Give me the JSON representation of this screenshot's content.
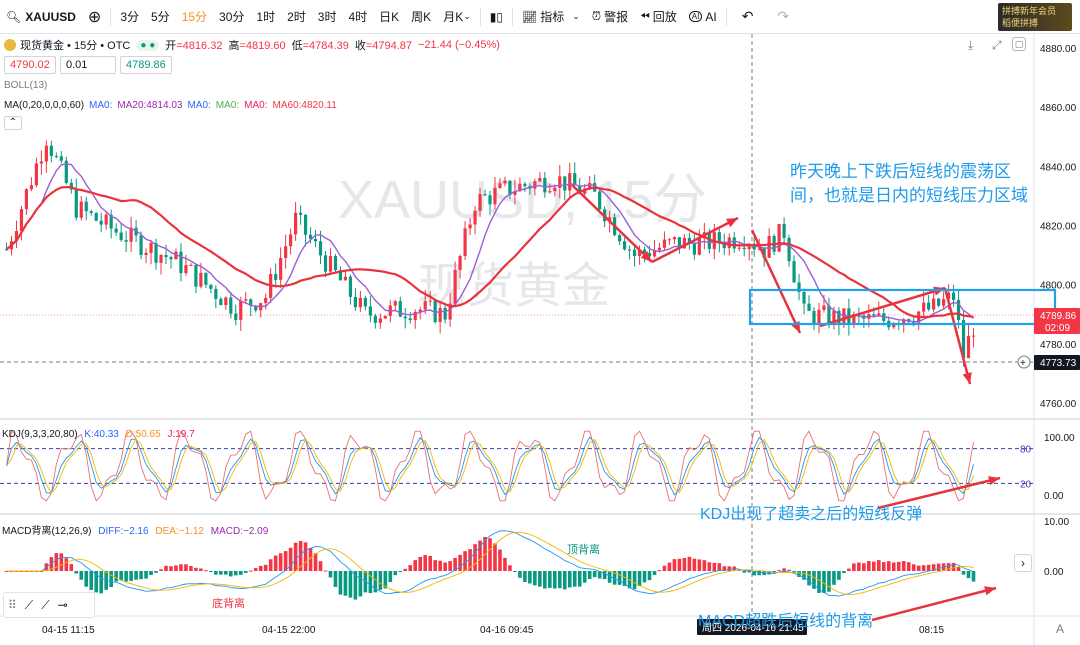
{
  "toolbar": {
    "symbol": "XAUUSD",
    "add_icon": "⊕",
    "intervals": [
      "3分",
      "5分",
      "15分",
      "30分",
      "1时",
      "2时",
      "3时",
      "4时",
      "日K",
      "周K",
      "月K"
    ],
    "active_interval": "15分",
    "indicators": "指标",
    "alerts": "警报",
    "replay": "回放",
    "ai": "AI",
    "promo_line1": "拼搏新年会员",
    "promo_line2": "稻便拼搏"
  },
  "legend": {
    "name": "现货黄金 • 15分 • OTC",
    "open_label": "开",
    "open": "=4816.32",
    "high_label": "高",
    "high": "=4819.60",
    "low_label": "低",
    "low": "=4784.39",
    "close_label": "收",
    "close": "=4794.87",
    "change": "−21.44 (−0.45%)"
  },
  "price_boxes": {
    "sell": "4790.02",
    "spread": "0.01",
    "buy": "4789.86"
  },
  "indicators": {
    "boll": "BOLL(13)",
    "ma_header": "MA(0,20,0,0,0,60)",
    "ma_items": [
      {
        "text": "MA0:",
        "color": "#2962ff"
      },
      {
        "text": "MA20:4814.03",
        "color": "#9c27b0"
      },
      {
        "text": "MA0:",
        "color": "#2962ff"
      },
      {
        "text": "MA0:",
        "color": "#4caf50"
      },
      {
        "text": "MA0:",
        "color": "#e91e63"
      },
      {
        "text": "MA60:4820.11",
        "color": "#f23645"
      }
    ],
    "kdj_header": "KDJ(9,3,3,20,80)",
    "kdj_k": "K:40.33",
    "kdj_d": "D:50.65",
    "kdj_j": "J:19.7",
    "macd_header": "MACD背离(12,26,9)",
    "macd_diff": "DIFF:−2.16",
    "macd_dea": "DEA:−1.12",
    "macd_val": "MACD:−2.09"
  },
  "price_axis": {
    "ticks": [
      "4880.00",
      "4860.00",
      "4840.00",
      "4820.00",
      "4800.00",
      "4780.00",
      "4760.00"
    ],
    "current_price": "4789.86",
    "countdown": "02:09",
    "cursor_price": "4773.73"
  },
  "kdj_axis": {
    "ticks": [
      "100.00",
      "0.00"
    ],
    "levels": [
      "80",
      "20"
    ]
  },
  "macd_axis": {
    "ticks": [
      "10.00",
      "0.00"
    ]
  },
  "time_axis": {
    "ticks": [
      "04-15 11:15",
      "04-15 22:00",
      "04-16 09:45",
      "08:15"
    ],
    "cursor_time": "周四 2026-04-16 21:45"
  },
  "watermark": {
    "line1": "XAUUSD, 15分",
    "line2": "现货黄金"
  },
  "annotations": {
    "a1": "昨天晚上下跌后短线的震荡区间，也就是日内的短线压力区域",
    "a2": "KDJ出现了超卖之后的短线反弹",
    "a3": "MACD超跌后短线的背离",
    "bottom_div": "底背离",
    "top_div": "顶背离"
  },
  "colors": {
    "up": "#f23645",
    "down": "#089981",
    "ma60": "#e8333f",
    "ma20": "#9c5ed6",
    "accent": "#f7931a",
    "annot": "#1e9be8",
    "box": "#1ea3e8"
  }
}
